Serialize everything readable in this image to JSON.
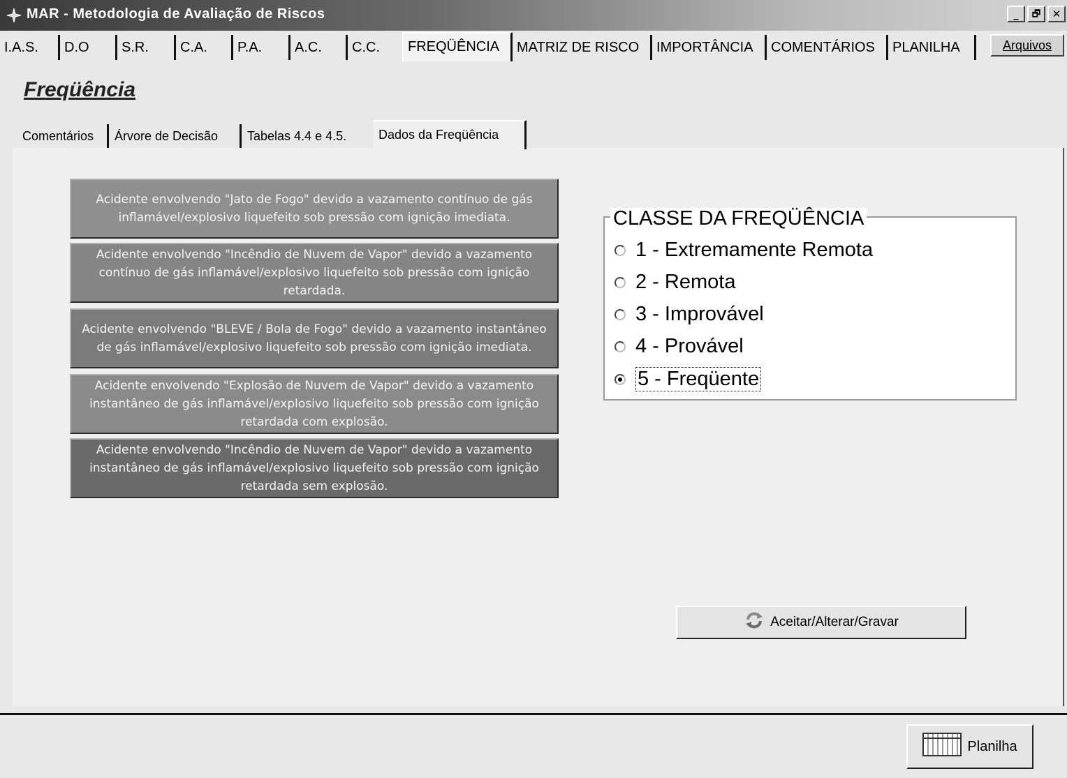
{
  "window": {
    "title": "MAR - Metodologia de Avaliação de Riscos",
    "minimize_glyph": "_",
    "maximize_glyph": "🗗",
    "close_glyph": "✕",
    "app_icon": "app-icon"
  },
  "main_tabs": {
    "items": [
      {
        "label": "I.A.S."
      },
      {
        "label": "D.O"
      },
      {
        "label": "S.R."
      },
      {
        "label": "C.A."
      },
      {
        "label": "P.A."
      },
      {
        "label": "A.C."
      },
      {
        "label": "C.C."
      },
      {
        "label": "FREQÜÊNCIA"
      },
      {
        "label": "MATRIZ DE RISCO"
      },
      {
        "label": "IMPORTÂNCIA"
      },
      {
        "label": "COMENTÁRIOS"
      },
      {
        "label": "PLANILHA"
      }
    ],
    "active": "FREQÜÊNCIA",
    "arquivos_label": "Arquivos"
  },
  "page_title": "Freqüência",
  "sub_tabs": {
    "items": [
      {
        "label": "Comentários"
      },
      {
        "label": "Árvore de Decisão"
      },
      {
        "label": "Tabelas 4.4 e 4.5."
      },
      {
        "label": "Dados da Freqüência"
      }
    ],
    "active": "Dados da Freqüência"
  },
  "accidents": [
    {
      "text": "Acidente envolvendo \"Jato de Fogo\" devido a vazamento contínuo de gás inflamável/explosivo liquefeito sob pressão com ignição imediata.",
      "color": "#8f8f8f"
    },
    {
      "text": "Acidente envolvendo \"Incêndio de Nuvem de Vapor\" devido a vazamento contínuo de gás inflamável/explosivo liquefeito sob pressão com ignição retardada.",
      "color": "#858585"
    },
    {
      "text": "Acidente envolvendo \"BLEVE / Bola de Fogo\" devido a vazamento instantâneo de gás inflamável/explosivo liquefeito sob pressão com ignição imediata.",
      "color": "#7b7b7b"
    },
    {
      "text": "Acidente envolvendo \"Explosão de Nuvem de Vapor\" devido a vazamento instantâneo de gás inflamável/explosivo liquefeito sob pressão com ignição retardada com explosão.",
      "color": "#8a8a8a"
    },
    {
      "text": "Acidente envolvendo \"Incêndio de Nuvem de Vapor\" devido a vazamento instantâneo de gás inflamável/explosivo liquefeito sob pressão com ignição retardada sem explosão.",
      "color": "#6a6a6a"
    }
  ],
  "frequency_class": {
    "legend": "CLASSE DA FREQÜÊNCIA",
    "options": [
      {
        "label": "1 - Extremamente Remota",
        "checked": false
      },
      {
        "label": "2 - Remota",
        "checked": false
      },
      {
        "label": "3 - Improvável",
        "checked": false
      },
      {
        "label": "4 - Provável",
        "checked": false
      },
      {
        "label": "5 - Freqüente",
        "checked": true
      }
    ]
  },
  "actions": {
    "accept_label": "Aceitar/Alterar/Gravar",
    "accept_icon": "refresh-icon",
    "planilha_label": "Planilha",
    "planilha_icon": "spreadsheet-icon"
  }
}
